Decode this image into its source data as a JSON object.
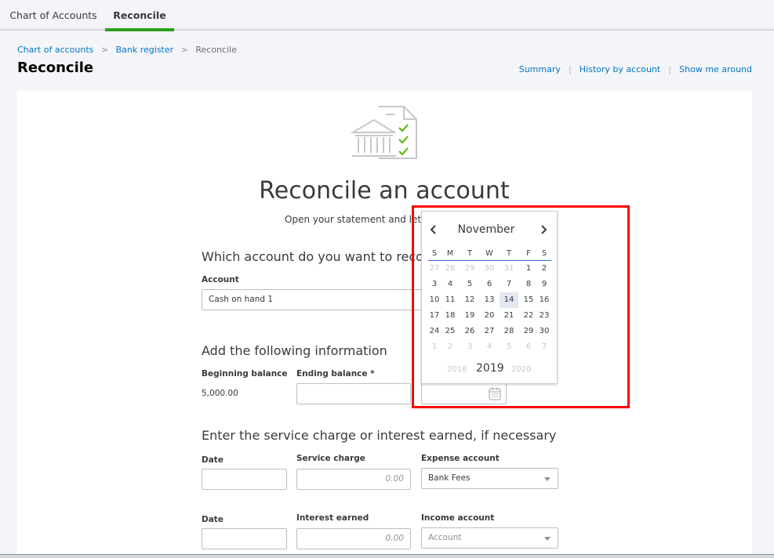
{
  "tabs": [
    {
      "label": "Chart of Accounts"
    },
    {
      "label": "Reconcile",
      "active": true
    }
  ],
  "breadcrumb": {
    "items": [
      "Chart of accounts",
      "Bank register"
    ],
    "current": "Reconcile",
    "separator": ">"
  },
  "page_title": "Reconcile",
  "header_links": [
    "Summary",
    "History by account",
    "Show me around"
  ],
  "card": {
    "title": "Reconcile an account",
    "subtitle": "Open your statement and let",
    "section1": {
      "heading": "Which account do you want to recon",
      "account_label": "Account",
      "account_value": "Cash on hand 1"
    },
    "section2": {
      "heading": "Add the following information",
      "beginning_label": "Beginning balance",
      "beginning_value": "5,000.00",
      "ending_label": "Ending balance *",
      "ending_value": ""
    },
    "section3": {
      "heading": "Enter the service charge or interest earned, if necessary",
      "row1": {
        "date_label": "Date",
        "amount_label": "Service charge",
        "amount_placeholder": "0.00",
        "account_label": "Expense account",
        "account_value": "Bank Fees"
      },
      "row2": {
        "date_label": "Date",
        "amount_label": "Interest earned",
        "amount_placeholder": "0.00",
        "account_label": "Income account",
        "account_placeholder": "Account"
      }
    }
  },
  "calendar": {
    "month": "November",
    "year": "2019",
    "prev_year": "2018",
    "next_year": "2020",
    "selected": "14",
    "weekdays": [
      "S",
      "M",
      "T",
      "W",
      "T",
      "F",
      "S"
    ],
    "weeks": [
      [
        "27",
        "28",
        "29",
        "30",
        "31",
        "1",
        "2"
      ],
      [
        "3",
        "4",
        "5",
        "6",
        "7",
        "8",
        "9"
      ],
      [
        "10",
        "11",
        "12",
        "13",
        "14",
        "15",
        "16"
      ],
      [
        "17",
        "18",
        "19",
        "20",
        "21",
        "22",
        "23"
      ],
      [
        "24",
        "25",
        "26",
        "27",
        "28",
        "29",
        "30"
      ],
      [
        "1",
        "2",
        "3",
        "4",
        "5",
        "6",
        "7"
      ]
    ],
    "icons": {
      "prev": "chevron-left-icon",
      "next": "chevron-right-icon",
      "date_input": "calendar-icon"
    }
  },
  "colors": {
    "accent_green": "#2ca01c",
    "link_blue": "#0077c5",
    "highlight_red": "#ff0000",
    "calendar_rule": "#2e6bd1"
  }
}
